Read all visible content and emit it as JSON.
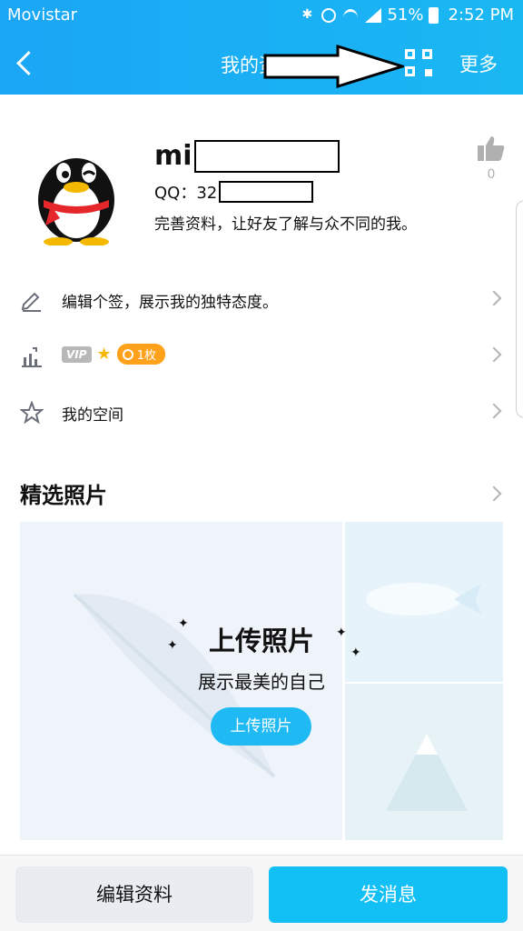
{
  "status_bar": {
    "carrier": "Movistar",
    "battery": "51%",
    "time": "2:52 PM"
  },
  "navbar": {
    "title": "我的资",
    "more_label": "更多"
  },
  "profile": {
    "name": "mi",
    "qq_label": "QQ：32",
    "description": "完善资料，让好友了解与众不同的我。",
    "like_count": "0"
  },
  "menu": {
    "signature": "编辑个签，展示我的独特态度。",
    "vip_badge": "VIP",
    "coin_count": "1枚",
    "space": "我的空间"
  },
  "photos": {
    "section_title": "精选照片",
    "upload_title": "上传照片",
    "upload_subtitle": "展示最美的自己",
    "upload_button": "上传照片"
  },
  "actions": {
    "edit_profile": "编辑资料",
    "send_message": "发消息"
  },
  "colors": {
    "header_blue": "#1ab0f4",
    "primary_button": "#13c0f6",
    "coin_orange": "#ffa11a"
  }
}
